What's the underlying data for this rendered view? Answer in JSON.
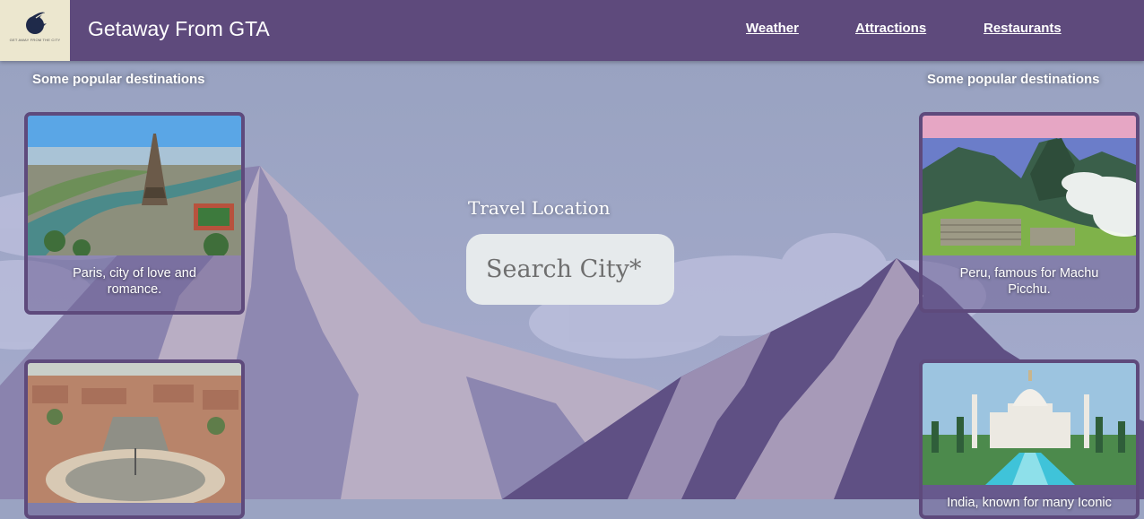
{
  "header": {
    "logo_text": "GET AWAY FROM THE CITY",
    "title": "Getaway From GTA",
    "nav": [
      "Weather",
      "Attractions",
      "Restaurants"
    ]
  },
  "left_column": {
    "heading": "Some popular destinations",
    "cards": [
      {
        "caption": "Paris, city of love and romance.",
        "image": "eiffel-tower-photo"
      },
      {
        "caption": "",
        "image": "vatican-square-photo"
      }
    ]
  },
  "right_column": {
    "heading": "Some popular destinations",
    "cards": [
      {
        "caption": "Peru, famous for Machu Picchu.",
        "image": "machu-picchu-photo"
      },
      {
        "caption": "India, known for many Iconic",
        "image": "taj-mahal-photo"
      }
    ]
  },
  "search": {
    "label": "Travel Location",
    "placeholder": "Search City*"
  },
  "colors": {
    "navbar": "#5e4a7c",
    "background": "#9aa3c2",
    "card_border": "#5e4a7c",
    "search_field": "#e6eaec"
  }
}
